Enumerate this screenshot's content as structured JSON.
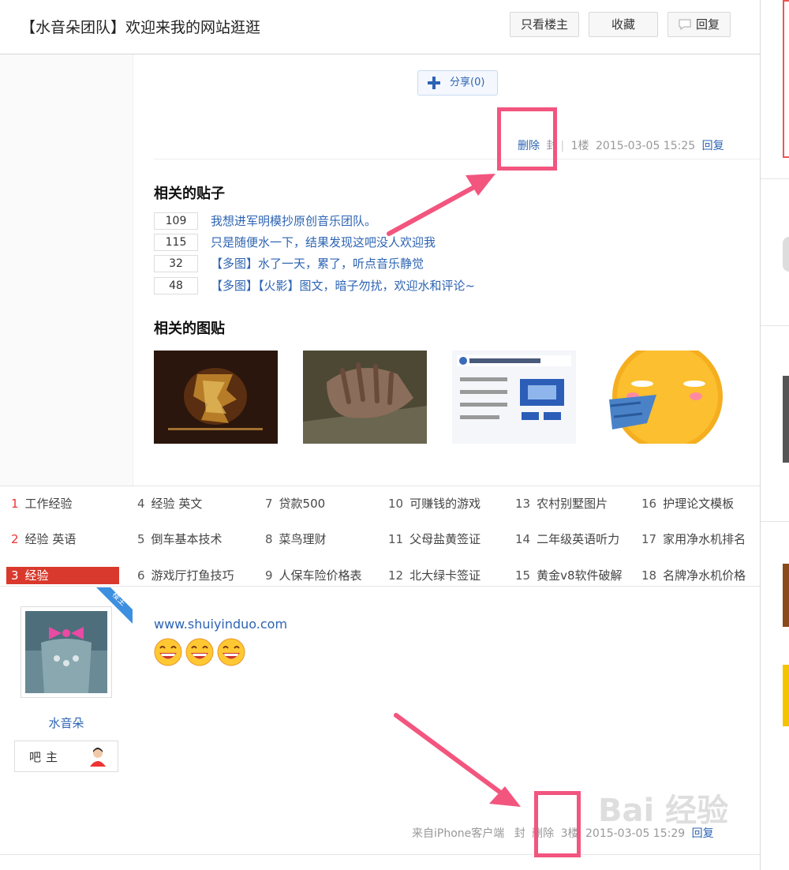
{
  "header": {
    "title": "【水音朵团队】欢迎来我的网站逛逛",
    "buttons": {
      "only_op": "只看楼主",
      "favorite": "收藏",
      "reply": "回复"
    }
  },
  "share": {
    "label": "分享(0)"
  },
  "floor1": {
    "delete": "删除",
    "ban": "封",
    "floor": "1楼",
    "time": "2015-03-05 15:25",
    "reply": "回复"
  },
  "related_posts": {
    "title": "相关的贴子",
    "items": [
      {
        "count": "109",
        "text": "我想进军明模抄原创音乐团队。"
      },
      {
        "count": "115",
        "text": "只是随便水一下，结果发现这吧没人欢迎我"
      },
      {
        "count": "32",
        "text": "【多图】水了一天，累了，听点音乐静觉"
      },
      {
        "count": "48",
        "text": "【多图】【火影】图文，暗子勿扰，欢迎水和评论~"
      }
    ]
  },
  "related_pics": {
    "title": "相关的图贴"
  },
  "hot_searches": [
    {
      "n": "1",
      "t": "工作经验"
    },
    {
      "n": "2",
      "t": "经验 英语"
    },
    {
      "n": "3",
      "t": "经验"
    },
    {
      "n": "4",
      "t": "经验 英文"
    },
    {
      "n": "5",
      "t": "倒车基本技术"
    },
    {
      "n": "6",
      "t": "游戏厅打鱼技巧"
    },
    {
      "n": "7",
      "t": "贷款500"
    },
    {
      "n": "8",
      "t": "菜鸟理财"
    },
    {
      "n": "9",
      "t": "人保车险价格表"
    },
    {
      "n": "10",
      "t": "可赚钱的游戏"
    },
    {
      "n": "11",
      "t": "父母盐黄签证"
    },
    {
      "n": "12",
      "t": "北大绿卡签证"
    },
    {
      "n": "13",
      "t": "农村别墅图片"
    },
    {
      "n": "14",
      "t": "二年级英语听力"
    },
    {
      "n": "15",
      "t": "黄金v8软件破解"
    },
    {
      "n": "16",
      "t": "护理论文模板"
    },
    {
      "n": "17",
      "t": "家用净水机排名"
    },
    {
      "n": "18",
      "t": "名牌净水机价格"
    }
  ],
  "floor2": {
    "badge": "楼主",
    "username": "水音朵",
    "role": "吧主",
    "url_text": "www.shuiyinduo.com",
    "source": "来自iPhone客户端",
    "ban": "封",
    "delete": "删除",
    "floor": "3楼",
    "time": "2015-03-05 15:29",
    "reply": "回复"
  },
  "watermark": "Bai 经验",
  "colors": {
    "link": "#2d64b3",
    "highlight": "#f2557e",
    "hot_red": "#d9392c"
  }
}
